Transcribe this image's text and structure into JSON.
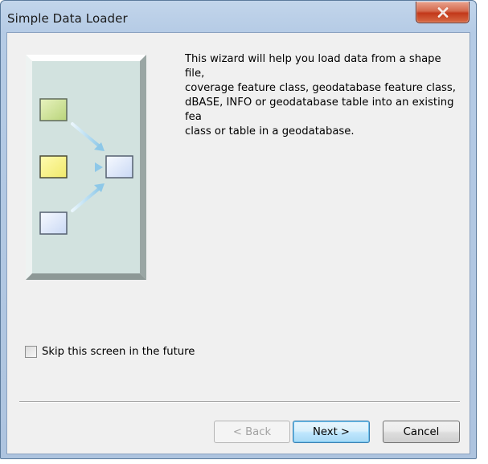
{
  "window": {
    "title": "Simple Data Loader"
  },
  "intro": {
    "description": "This wizard will help you load data from a shape file,\ncoverage feature class, geodatabase feature class,\ndBASE, INFO or geodatabase table into an existing fea\nclass or table in a geodatabase."
  },
  "options": {
    "skip_label": "Skip this screen in the future",
    "skip_checked": false
  },
  "buttons": {
    "back": "< Back",
    "next": "Next >",
    "cancel": "Cancel"
  },
  "colors": {
    "illustration_bg": "#d2e2df",
    "source_green": "#c9e08f",
    "source_yellow": "#fbf78a",
    "target_blue": "#dfe9fb",
    "arrow": "#8ec8e8"
  },
  "icons": {
    "close": "close-icon",
    "illustration": "data-flow-illustration"
  }
}
